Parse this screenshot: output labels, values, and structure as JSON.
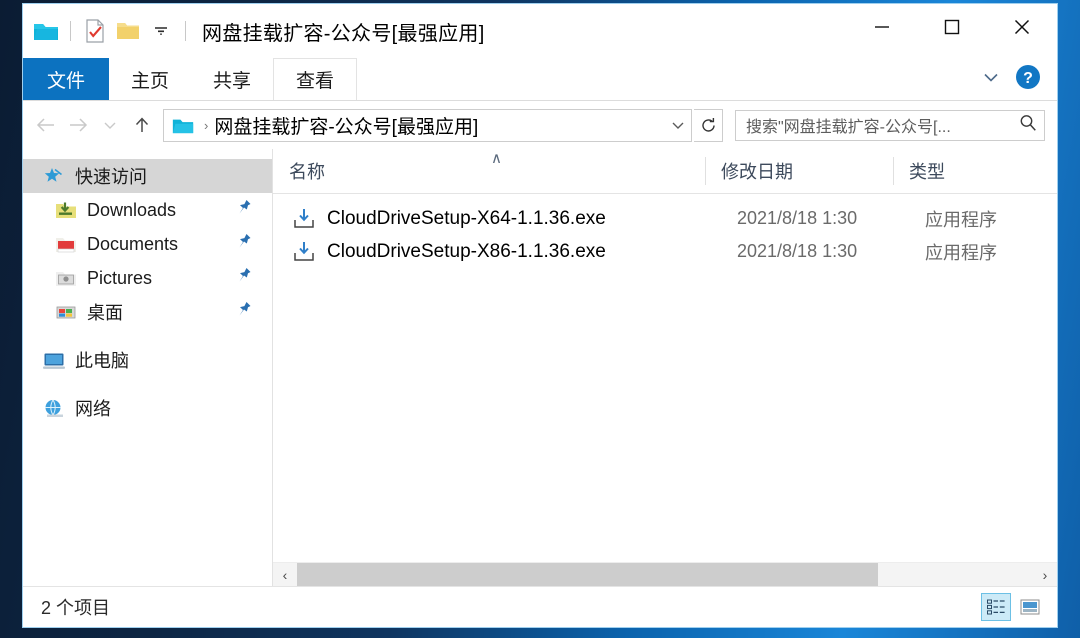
{
  "window": {
    "title": "网盘挂载扩容-公众号[最强应用]",
    "controls": {
      "minimize": "—",
      "maximize": "☐",
      "close": "✕"
    },
    "quick_access_toolbar": {
      "folder_icon": "folder-icon",
      "properties_icon": "properties-icon",
      "new_folder_icon": "new-folder-icon",
      "customize_icon": "chevron-down-icon"
    }
  },
  "ribbon": {
    "tabs": [
      {
        "label": "文件",
        "id": "file",
        "state": "highlighted"
      },
      {
        "label": "主页",
        "id": "home",
        "state": "normal"
      },
      {
        "label": "共享",
        "id": "share",
        "state": "normal"
      },
      {
        "label": "查看",
        "id": "view",
        "state": "outlined"
      }
    ],
    "expand_icon": "chevron-down-icon",
    "help_icon": "help-icon",
    "help_glyph": "?"
  },
  "navigation": {
    "back_icon": "arrow-left-icon",
    "forward_icon": "arrow-right-icon",
    "recent_icon": "chevron-down-icon",
    "up_icon": "arrow-up-icon",
    "refresh_icon": "refresh-icon",
    "refresh_glyph": "↻",
    "address": {
      "icon": "folder-icon",
      "separator": "›",
      "path_text": "网盘挂载扩容-公众号[最强应用]",
      "dropdown_icon": "chevron-down-icon"
    }
  },
  "search": {
    "placeholder": "搜索\"网盘挂载扩容-公众号[...",
    "icon": "search-icon"
  },
  "sidebar": {
    "items": [
      {
        "label": "快速访问",
        "icon": "star-pin-icon",
        "selected": true,
        "pinned": false,
        "child": false
      },
      {
        "label": "Downloads",
        "icon": "downloads-folder-icon",
        "selected": false,
        "pinned": true,
        "child": true
      },
      {
        "label": "Documents",
        "icon": "documents-folder-icon",
        "selected": false,
        "pinned": true,
        "child": true
      },
      {
        "label": "Pictures",
        "icon": "pictures-folder-icon",
        "selected": false,
        "pinned": true,
        "child": true
      },
      {
        "label": "桌面",
        "icon": "desktop-folder-icon",
        "selected": false,
        "pinned": true,
        "child": true
      },
      {
        "label": "此电脑",
        "icon": "this-pc-icon",
        "selected": false,
        "pinned": false,
        "child": false
      },
      {
        "label": "网络",
        "icon": "network-icon",
        "selected": false,
        "pinned": false,
        "child": false
      }
    ]
  },
  "file_list": {
    "columns": [
      {
        "label": "名称",
        "sorted": "asc",
        "sort_glyph": "∧"
      },
      {
        "label": "修改日期",
        "sorted": null,
        "sort_glyph": ""
      },
      {
        "label": "类型",
        "sorted": null,
        "sort_glyph": ""
      }
    ],
    "rows": [
      {
        "icon": "installer-icon",
        "name": "CloudDriveSetup-X64-1.1.36.exe",
        "date": "2021/8/18 1:30",
        "type": "应用程序"
      },
      {
        "icon": "installer-icon",
        "name": "CloudDriveSetup-X86-1.1.36.exe",
        "date": "2021/8/18 1:30",
        "type": "应用程序"
      }
    ]
  },
  "scrollbar": {
    "left_arrow": "‹",
    "right_arrow": "›",
    "thumb_percent": 79
  },
  "status_bar": {
    "item_count_text": "2 个项目",
    "view_buttons": [
      {
        "name": "details-view",
        "selected": true
      },
      {
        "name": "large-icons-view",
        "selected": false
      }
    ]
  },
  "colors": {
    "accent": "#0c72c0",
    "selection": "#d6d6d6",
    "view_selected": "#cceaf7",
    "desktop": "#0f3560"
  }
}
